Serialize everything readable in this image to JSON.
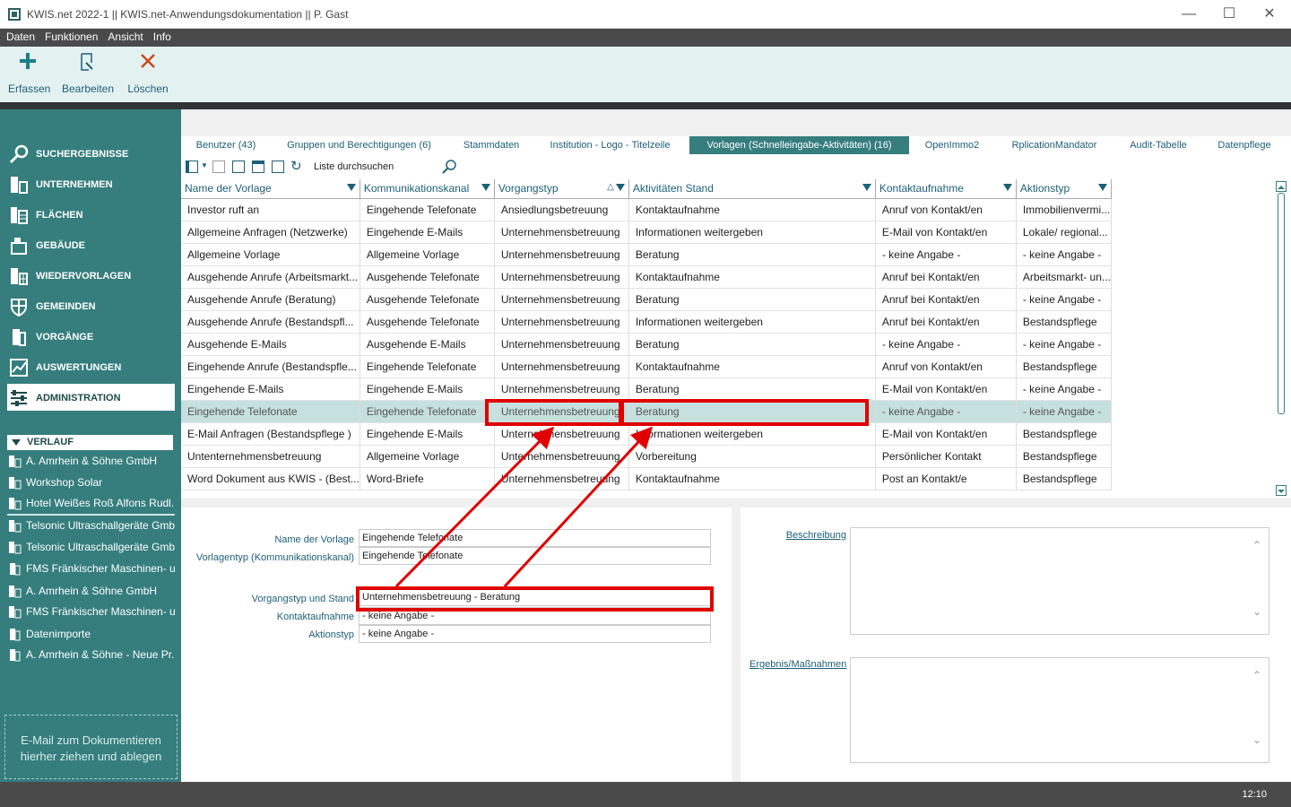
{
  "window": {
    "title": "KWIS.net 2022-1 || KWIS.net-Anwendungsdokumentation || P. Gast"
  },
  "menu": [
    "Daten",
    "Funktionen",
    "Ansicht",
    "Info"
  ],
  "toolbar": {
    "add_label": "Erfassen",
    "edit_label": "Bearbeiten",
    "delete_label": "Löschen"
  },
  "sidebar": {
    "items": [
      {
        "label": "SUCHERGEBNISSE"
      },
      {
        "label": "UNTERNEHMEN"
      },
      {
        "label": "FLÄCHEN"
      },
      {
        "label": "GEBÄUDE"
      },
      {
        "label": "WIEDERVORLAGEN"
      },
      {
        "label": "GEMEINDEN"
      },
      {
        "label": "VORGÄNGE"
      },
      {
        "label": "AUSWERTUNGEN"
      },
      {
        "label": "ADMINISTRATION",
        "active": true
      }
    ],
    "history_title": "VERLAUF",
    "history": [
      "A. Amrhein & Söhne GmbH",
      "Workshop Solar",
      "Hotel Weißes Roß Alfons Rudl...",
      "Telsonic Ultraschallgeräte Gmb...",
      "Telsonic Ultraschallgeräte Gmb...",
      "FMS Fränkischer Maschinen- u...",
      "A. Amrhein & Söhne GmbH",
      "FMS Fränkischer Maschinen- u...",
      "Datenimporte",
      "A. Amrhein & Söhne - Neue Pr..."
    ],
    "dropzone": "E-Mail  zum Dokumentieren hierher ziehen und ablegen"
  },
  "tabs": [
    "Benutzer (43)",
    "Gruppen und Berechtigungen (6)",
    "Stammdaten",
    "Institution - Logo - Titelzeile",
    "Vorlagen (Schnelleingabe-Aktivitäten) (16)",
    "OpenImmo2",
    "RplicationMandator",
    "Audit-Tabelle",
    "Datenpflege"
  ],
  "active_tab": "Vorlagen (Schnelleingabe-Aktivitäten) (16)",
  "search": {
    "placeholder": "Liste durchsuchen"
  },
  "grid": {
    "columns": [
      "Name der Vorlage",
      "Kommunikationskanal",
      "Vorgangstyp",
      "Aktivitäten Stand",
      "Kontaktaufnahme",
      "Aktionstyp"
    ],
    "rows": [
      [
        "Investor ruft an",
        "Eingehende Telefonate",
        "Ansiedlungsbetreuung",
        "Kontaktaufnahme",
        "Anruf von Kontakt/en",
        "Immobilienvermi..."
      ],
      [
        "Allgemeine Anfragen (Netzwerke)",
        "Eingehende E-Mails",
        "Unternehmensbetreuung",
        "Informationen weitergeben",
        "E-Mail von Kontakt/en",
        "Lokale/ regional..."
      ],
      [
        "Allgemeine Vorlage",
        "Allgemeine Vorlage",
        "Unternehmensbetreuung",
        "Beratung",
        "- keine Angabe -",
        "- keine Angabe -"
      ],
      [
        "Ausgehende Anrufe (Arbeitsmarkt...",
        "Ausgehende Telefonate",
        "Unternehmensbetreuung",
        "Kontaktaufnahme",
        "Anruf bei Kontakt/en",
        "Arbeitsmarkt- un..."
      ],
      [
        "Ausgehende Anrufe (Beratung)",
        "Ausgehende Telefonate",
        "Unternehmensbetreuung",
        "Beratung",
        "Anruf bei Kontakt/en",
        "- keine Angabe -"
      ],
      [
        "Ausgehende Anrufe (Bestandspfl...",
        "Ausgehende Telefonate",
        "Unternehmensbetreuung",
        "Informationen weitergeben",
        "Anruf bei Kontakt/en",
        "Bestandspflege"
      ],
      [
        "Ausgehende E-Mails",
        "Ausgehende E-Mails",
        "Unternehmensbetreuung",
        "Beratung",
        "- keine Angabe -",
        "- keine Angabe -"
      ],
      [
        "Eingehende Anrufe (Bestandspfle...",
        "Eingehende Telefonate",
        "Unternehmensbetreuung",
        "Kontaktaufnahme",
        "Anruf von Kontakt/en",
        "Bestandspflege"
      ],
      [
        "Eingehende E-Mails",
        "Eingehende E-Mails",
        "Unternehmensbetreuung",
        "Beratung",
        "E-Mail von Kontakt/en",
        "- keine Angabe -"
      ],
      [
        "Eingehende Telefonate",
        "Eingehende Telefonate",
        "Unternehmensbetreuung",
        "Beratung",
        "- keine Angabe -",
        "- keine Angabe -"
      ],
      [
        "E-Mail Anfragen (Bestandspflege )",
        "Eingehende E-Mails",
        "Unternehmensbetreuung",
        "Informationen weitergeben",
        "E-Mail von Kontakt/en",
        "Bestandspflege"
      ],
      [
        "Untenternehmensbetreuung",
        "Allgemeine Vorlage",
        "Unternehmensbetreuung",
        "Vorbereitung",
        "Persönlicher Kontakt",
        "Bestandspflege"
      ],
      [
        "Word Dokument aus KWIS - (Best...",
        "Word-Briefe",
        "Unternehmensbetreuung",
        "Kontaktaufnahme",
        "Post an Kontakt/e",
        "Bestandspflege"
      ]
    ],
    "selected_row": 9
  },
  "detail": {
    "labels": {
      "name": "Name der Vorlage",
      "type": "Vorlagentyp (Kommunikationskanal)",
      "process": "Vorgangstyp und Stand",
      "contact": "Kontaktaufnahme",
      "action": "Aktionstyp"
    },
    "values": {
      "name": "Eingehende Telefonate",
      "type": "Eingehende Telefonate",
      "process": "Unternehmensbetreuung - Beratung",
      "contact": "- keine Angabe -",
      "action": "- keine Angabe -"
    },
    "right": {
      "description_label": "Beschreibung",
      "result_label": "Ergebnis/Maßnahmen"
    }
  },
  "status": {
    "time": "12:10"
  },
  "colors": {
    "sidebar": "#357e7d",
    "highlight": "#e00000",
    "selected_row": "#c6e0df",
    "accent_text": "#1d5f78"
  }
}
